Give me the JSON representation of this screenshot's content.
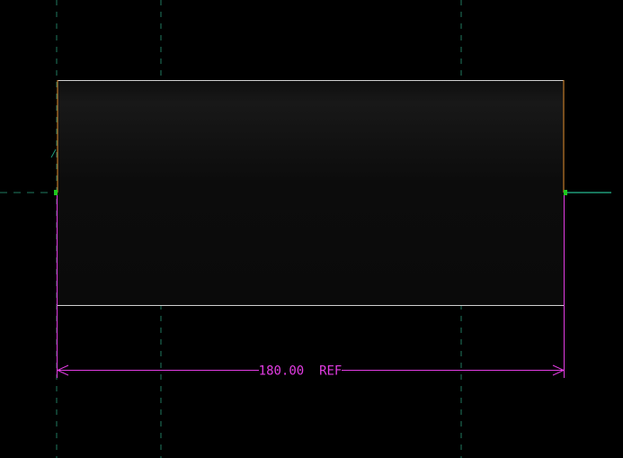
{
  "drawing": {
    "background_color": "#000000",
    "body_fill_color": "#0c0c0c",
    "outline_color": "#cfcfcf",
    "end_edge_color": "#c07a2a",
    "centerline_color": "#1f7a60",
    "dimension_color": "#e23ce2",
    "grip_color": "#1ec81e"
  },
  "dimension": {
    "label": "180.00  REF"
  }
}
